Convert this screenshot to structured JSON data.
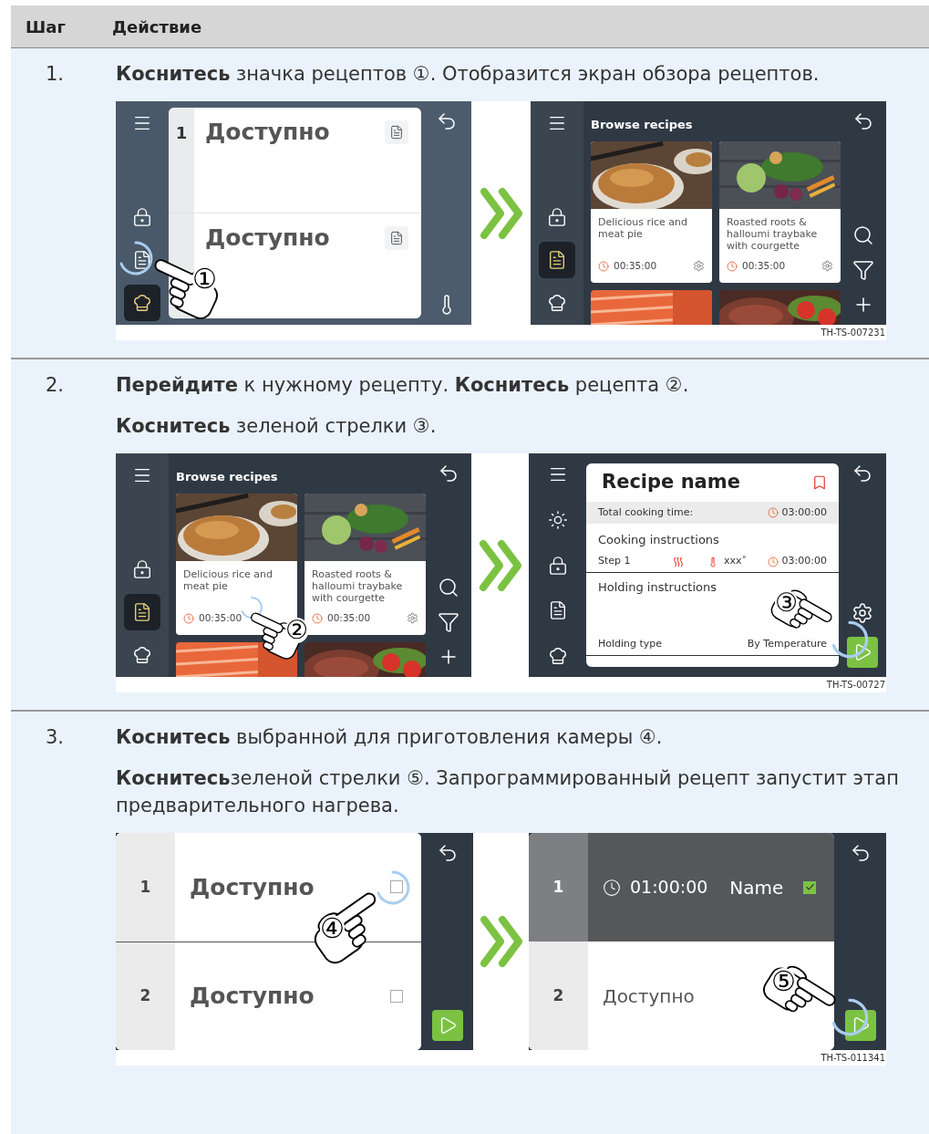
{
  "header": {
    "step": "Шаг",
    "action": "Действие"
  },
  "steps": [
    {
      "number": "1.",
      "paragraphs": [
        "**Коснитесь** значка рецептов ①. Отобразится экран обзора рецептов."
      ],
      "figure": {
        "id": "TH-TS-007231",
        "screens": [
          {
            "kind": "slots",
            "rail": [
              {
                "kind": "menu",
                "selected": false
              },
              {
                "kind": "lock",
                "selected": false
              },
              {
                "kind": "recipes",
                "selected": false
              },
              {
                "kind": "chef",
                "selected": true
              }
            ],
            "slots": [
              {
                "number": "1",
                "label": "Доступно"
              },
              {
                "label": "Доступно"
              }
            ],
            "tools": [
              {
                "kind": "back"
              },
              {
                "kind": "probe"
              }
            ],
            "touch": {
              "marker": "①",
              "kind": "rail"
            }
          },
          {
            "kind": "browse",
            "title": "Browse recipes",
            "rail": [
              {
                "kind": "menu",
                "selected": false
              },
              {
                "kind": "lock",
                "selected": false
              },
              {
                "kind": "recipes",
                "selected": true
              },
              {
                "kind": "chef",
                "selected": false
              }
            ],
            "cards": [
              {
                "title": "Delicious rice and meat pie",
                "time": "00:35:00",
                "gear": true
              },
              {
                "title": "Roasted roots & halloumi traybake with courgette",
                "time": "00:35:00",
                "gear": true
              },
              {
                "kind": "picture"
              },
              {
                "kind": "picture"
              }
            ],
            "tools": [
              {
                "kind": "back"
              },
              {
                "kind": "search"
              },
              {
                "kind": "filter"
              },
              {
                "kind": "add"
              }
            ]
          }
        ]
      }
    },
    {
      "number": "2.",
      "paragraphs": [
        "**Перейдите** к нужному рецепту. **Коснитесь** рецепта ②.",
        "**Коснитесь** зеленой стрелки ③."
      ],
      "figure": {
        "id": "TH-TS-00727",
        "screens": [
          {
            "kind": "browse",
            "title": "Browse recipes",
            "rail": [
              {
                "kind": "menu",
                "selected": false
              },
              {
                "kind": "lock",
                "selected": false
              },
              {
                "kind": "recipes",
                "selected": true
              },
              {
                "kind": "chef",
                "selected": false
              }
            ],
            "cards": [
              {
                "title": "Delicious rice and meat pie",
                "time": "00:35:00",
                "gear": false
              },
              {
                "title": "Roasted roots & halloumi traybake with courgette",
                "time": "00:35:00",
                "gear": true
              },
              {
                "kind": "picture"
              },
              {
                "kind": "picture"
              }
            ],
            "tools": [
              {
                "kind": "back"
              },
              {
                "kind": "search"
              },
              {
                "kind": "filter"
              },
              {
                "kind": "add"
              }
            ],
            "touch": {
              "marker": "②",
              "kind": "card"
            }
          },
          {
            "kind": "recipe",
            "title": "Recipe name",
            "total_label": "Total cooking time:",
            "total_time": "03:00:00",
            "cooking_heading": "Cooking instructions",
            "step": {
              "label": "Step 1",
              "value": "xxx˚",
              "time": "03:00:00"
            },
            "holding_heading": "Holding instructions",
            "holding": {
              "label": "Holding type",
              "value": "By Temperature"
            },
            "rail": [
              {
                "kind": "menu",
                "selected": false
              },
              {
                "kind": "sun",
                "selected": false
              },
              {
                "kind": "lock",
                "selected": false
              },
              {
                "kind": "recipes",
                "selected": false
              },
              {
                "kind": "chef",
                "selected": false
              }
            ],
            "tools": [
              {
                "kind": "back"
              },
              {
                "kind": "settings"
              },
              {
                "kind": "play"
              }
            ],
            "touch": {
              "marker": "③",
              "kind": "recipe-play"
            }
          }
        ]
      }
    },
    {
      "number": "3.",
      "paragraphs": [
        "**Коснитесь** выбранной для приготовления камеры ④.",
        "**Коснитесь**зеленой стрелки ⑤. Запрограммированный рецепт запустит этап предварительного нагрева."
      ],
      "figure": {
        "id": "TH-TS-011341",
        "screens": [
          {
            "kind": "chambers",
            "rows": [
              {
                "number": "1",
                "label": "Доступно",
                "checked": false,
                "selected": false
              },
              {
                "number": "2",
                "label": "Доступно",
                "checked": false,
                "selected": false
              }
            ],
            "tools": [
              {
                "kind": "back"
              },
              {
                "kind": "play"
              }
            ],
            "touch": {
              "marker": "④",
              "kind": "checkbox"
            }
          },
          {
            "kind": "chambers",
            "rows": [
              {
                "number": "1",
                "time": "01:00:00",
                "label": "Name",
                "checked": true,
                "selected": true
              },
              {
                "number": "2",
                "label": "Доступно",
                "selected": false
              }
            ],
            "tools": [
              {
                "kind": "back"
              },
              {
                "kind": "play"
              }
            ],
            "touch": {
              "marker": "⑤",
              "kind": "play"
            }
          }
        ]
      }
    }
  ]
}
